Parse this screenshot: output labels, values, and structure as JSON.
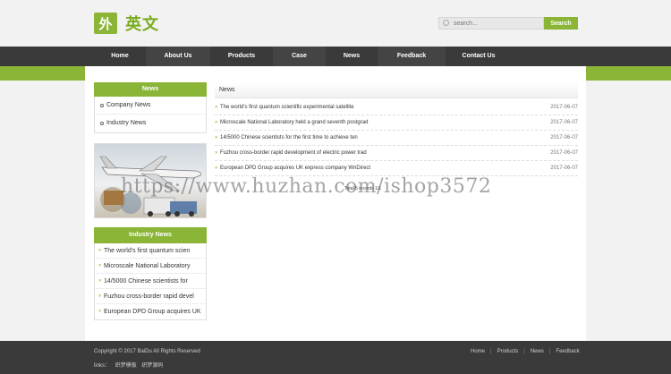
{
  "header": {
    "logo_mark": "外",
    "logo_text": "英文",
    "search_placeholder": "search...",
    "search_button": "Search"
  },
  "nav": [
    "Home",
    "About Us",
    "Products",
    "Case",
    "News",
    "Feedback",
    "Contact Us"
  ],
  "sidebar": {
    "news_title": "News",
    "news_items": [
      "Company News",
      "Industry News"
    ],
    "industry_title": "Industry News",
    "industry_items": [
      "The world's first quantum scien",
      "Microscale National Laboratory",
      "14/5000 Chinese scientists for",
      "Fuzhou cross-border rapid devel",
      "European DPD Group acquires UK"
    ]
  },
  "main": {
    "title": "News",
    "rows": [
      {
        "title": "The world's first quantum scientific experimental satellite",
        "date": "2017-06-07"
      },
      {
        "title": "Microscale National Laboratory held a grand seventh postgrad",
        "date": "2017-06-07"
      },
      {
        "title": "14/5000 Chinese scientists for the first time to achieve ten",
        "date": "2017-06-07"
      },
      {
        "title": "Fuzhou cross-border rapid development of electric power trad",
        "date": "2017-06-07"
      },
      {
        "title": "European DPD Group acquires UK express company WnDirect",
        "date": "2017-06-07"
      }
    ],
    "pager": "Total 5 records 1/1"
  },
  "watermark": "https://www.huzhan.com/ishop3572",
  "footer": {
    "copyright": "Copyright © 2017 BaiDu All Rights Reserved",
    "links_label": "links：",
    "links": [
      "织梦模板",
      "织梦源码"
    ],
    "nav": [
      "Home",
      "Products",
      "News",
      "Feedback"
    ]
  },
  "colors": {
    "accent": "#8ab536",
    "nav_bg": "#3a3a3a"
  }
}
